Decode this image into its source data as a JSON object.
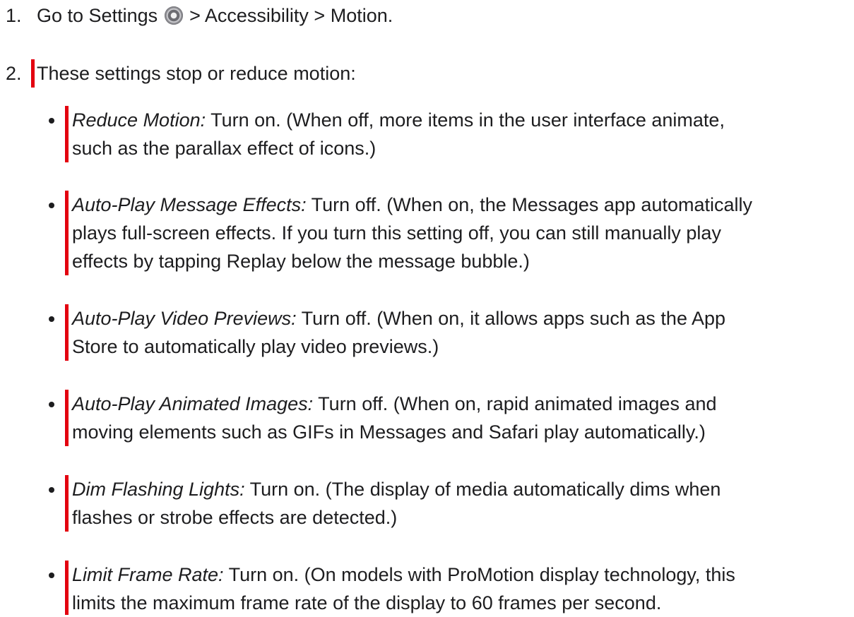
{
  "steps": [
    {
      "number": "1.",
      "before_icon": "Go to Settings ",
      "icon": "settings-gear-icon",
      "after_icon": " > Accessibility > Motion."
    },
    {
      "number": "2.",
      "text": "These settings stop or reduce motion:"
    }
  ],
  "items": [
    {
      "name": "Reduce Motion:",
      "line1": " Turn on. (When off, more items in the user interface animate,",
      "line2": "such as the parallax effect of icons.)"
    },
    {
      "name": "Auto-Play Message Effects:",
      "line1": " Turn off. (When on, the Messages app automatically",
      "line2": "plays full-screen effects. If you turn this setting off, you can still manually play",
      "line3": "effects by tapping Replay below the message bubble.)"
    },
    {
      "name": "Auto-Play Video Previews:",
      "line1": " Turn off. (When on, it allows apps such as the App",
      "line2": "Store to automatically play video previews.)"
    },
    {
      "name": "Auto-Play Animated Images:",
      "line1": " Turn off. (When on, rapid animated images and",
      "line2": "moving elements such as GIFs in Messages and Safari play automatically.)"
    },
    {
      "name": "Dim Flashing Lights:",
      "line1": " Turn on. (The display of media automatically dims when",
      "line2": "flashes or strobe effects are detected.)"
    },
    {
      "name": "Limit Frame Rate:",
      "line1": " Turn on. (On models with ProMotion display technology, this",
      "line2": "limits the maximum frame rate of the display to 60 frames per second."
    }
  ],
  "colors": {
    "marker": "#e3000f",
    "text": "#1d1d1f"
  }
}
